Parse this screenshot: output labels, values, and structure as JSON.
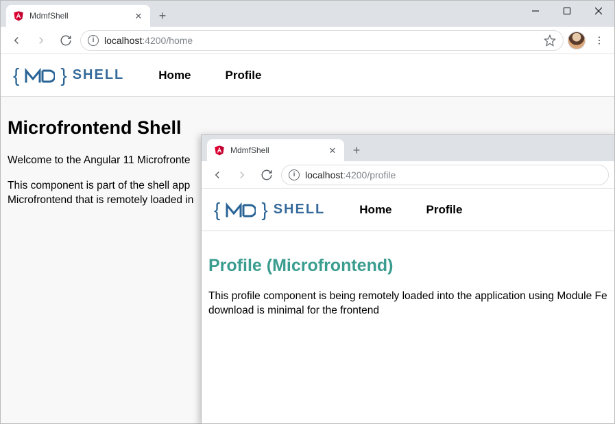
{
  "window_back": {
    "tab_title": "MdmfShell",
    "url_host": "localhost",
    "url_port": ":4200",
    "url_path": "/home",
    "nav": {
      "home": "Home",
      "profile": "Profile"
    },
    "logo_text": "SHELL",
    "page": {
      "heading": "Microfrontend Shell",
      "p1": "Welcome to the Angular 11 Microfronte",
      "p2": "This component is part of the shell app",
      "p3": "Microfrontend that is remotely loaded in"
    }
  },
  "window_front": {
    "tab_title": "MdmfShell",
    "url_host": "localhost",
    "url_port": ":4200",
    "url_path": "/profile",
    "nav": {
      "home": "Home",
      "profile": "Profile"
    },
    "logo_text": "SHELL",
    "page": {
      "heading": "Profile (Microfrontend)",
      "p1": "This profile component is being remotely loaded into the application using Module Fe",
      "p2": "download is minimal for the frontend"
    }
  }
}
